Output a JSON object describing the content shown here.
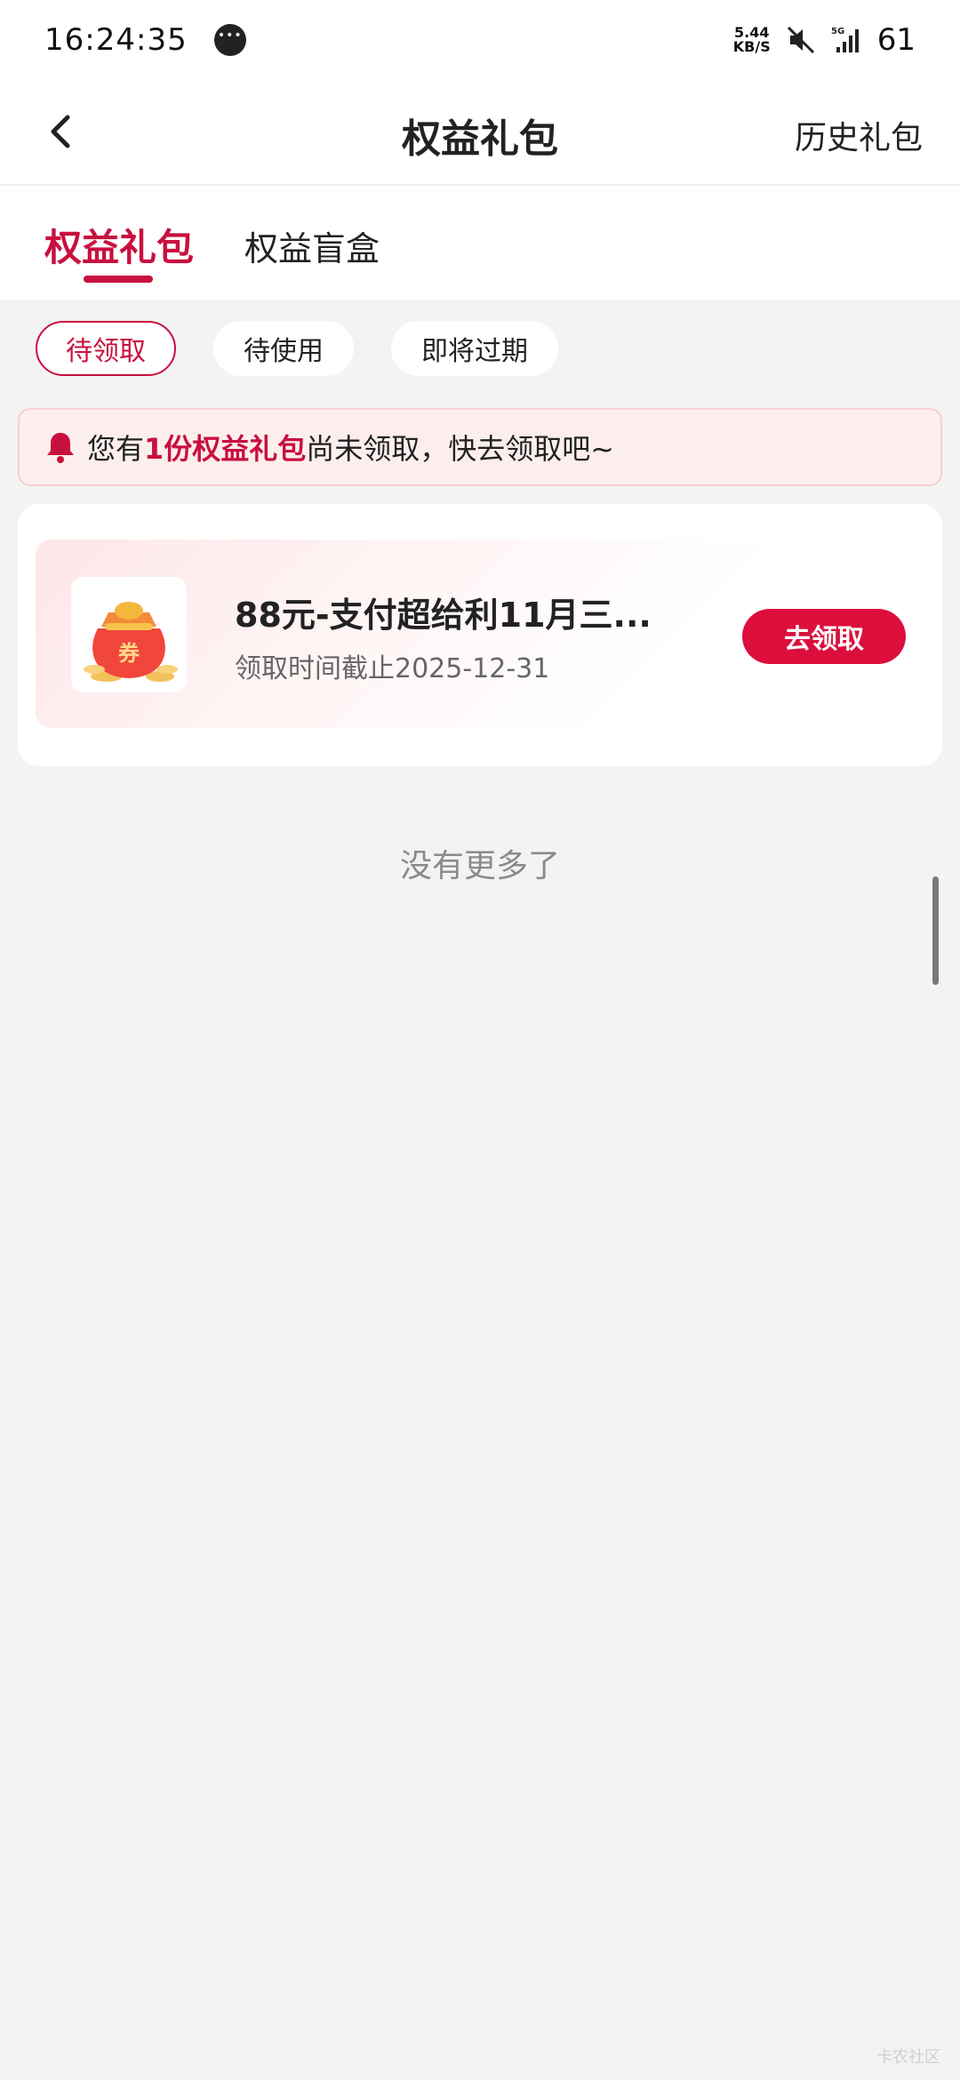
{
  "status_bar": {
    "time": "16:24:35",
    "net_speed_value": "5.44",
    "net_speed_unit": "KB/S",
    "signal_label": "5G",
    "battery": "61"
  },
  "nav": {
    "title": "权益礼包",
    "history_link": "历史礼包"
  },
  "tabs": [
    {
      "label": "权益礼包",
      "active": true
    },
    {
      "label": "权益盲盒",
      "active": false
    }
  ],
  "filters": [
    {
      "label": "待领取",
      "active": true
    },
    {
      "label": "待使用",
      "active": false
    },
    {
      "label": "即将过期",
      "active": false
    }
  ],
  "notice": {
    "prefix": "您有",
    "highlight": "1份权益礼包",
    "suffix": "尚未领取，快去领取吧~"
  },
  "gift_card": {
    "title": "88元-支付超给利11月三...",
    "deadline": "领取时间截止2025-12-31",
    "thumbnail_label": "券",
    "action_label": "去领取"
  },
  "list_end": "没有更多了",
  "watermark": "卡农社区",
  "colors": {
    "accent": "#c8103e",
    "button": "#dc0f3c",
    "notice_bg": "#fdeeee",
    "page_bg": "#f3f3f3"
  }
}
